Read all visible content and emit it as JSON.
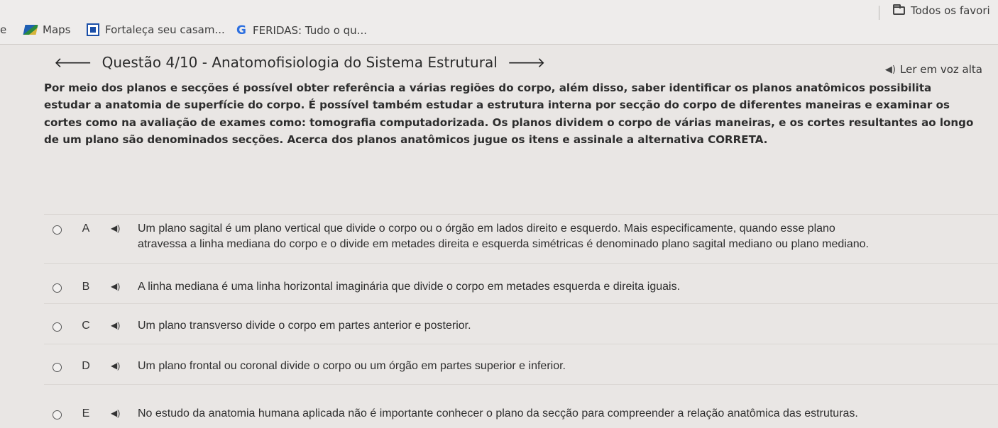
{
  "bookmarks": {
    "partial_left": "e",
    "maps": "Maps",
    "fortaleza": "Fortaleça seu casam...",
    "feridas": "FERIDAS: Tudo o qu...",
    "all_favorites": "Todos os favori"
  },
  "header": {
    "title": "Questão 4/10 - Anatomofisiologia do Sistema Estrutural",
    "read_aloud": "Ler em voz alta"
  },
  "question": {
    "statement": "Por meio dos planos e secções é possível obter referência a várias regiões do corpo, além disso, saber identificar os planos anatômicos possibilita\nestudar a anatomia de superfície do corpo. É possível também estudar a estrutura interna por secção do corpo de diferentes maneiras e examinar os\ncortes como na avaliação de exames como: tomografia computadorizada. Os planos dividem o corpo de várias maneiras, e os cortes resultantes ao longo\nde um plano são denominados secções. Acerca dos planos anatômicos jugue os itens e assinale a alternativa CORRETA."
  },
  "options": [
    {
      "letter": "A",
      "text": "Um plano sagital é um plano vertical que divide o corpo ou o órgão em lados direito e esquerdo. Mais especificamente, quando esse plano\natravessa a linha mediana do corpo e o divide em metades direita e esquerda simétricas é denominado plano sagital mediano ou plano mediano."
    },
    {
      "letter": "B",
      "text": "A linha mediana é uma linha horizontal imaginária que divide o corpo em metades esquerda e direita iguais."
    },
    {
      "letter": "C",
      "text": "Um plano transverso divide o corpo em partes anterior e posterior."
    },
    {
      "letter": "D",
      "text": "Um plano frontal ou coronal divide o corpo ou um órgão em partes superior e inferior."
    },
    {
      "letter": "E",
      "text": "No estudo da anatomia humana aplicada não é importante conhecer o plano da secção para compreender a relação anatômica das estruturas."
    }
  ]
}
